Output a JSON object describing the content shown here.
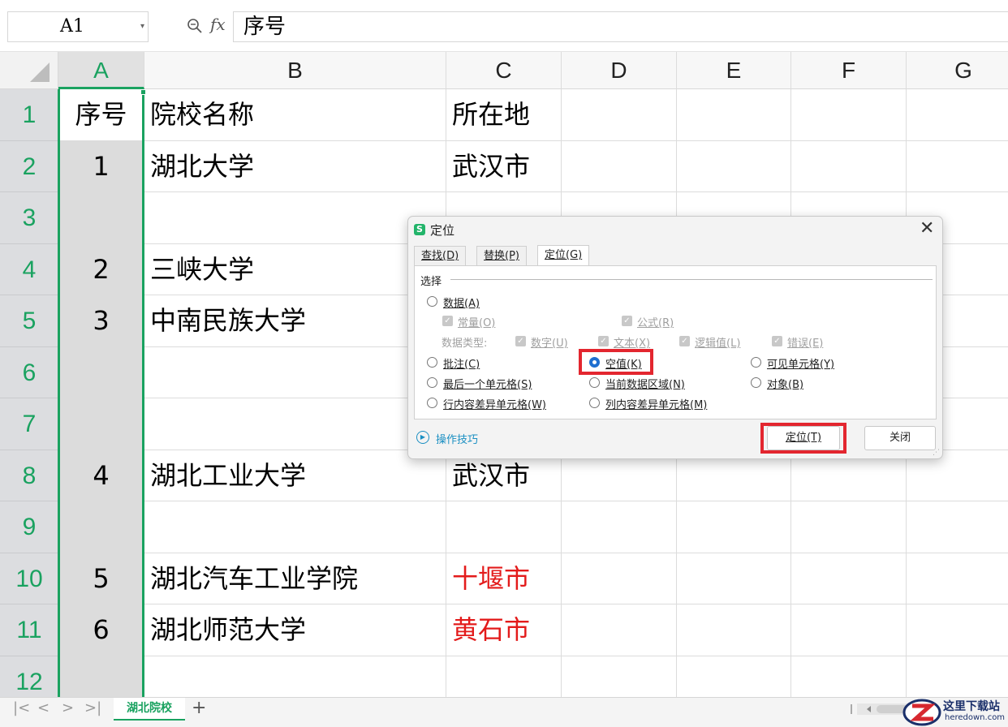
{
  "formula_bar": {
    "cell_ref": "A1",
    "fx_label": "fx",
    "content": "序号"
  },
  "columns": [
    "A",
    "B",
    "C",
    "D",
    "E",
    "F",
    "G"
  ],
  "rows": [
    {
      "num": "1",
      "a": "序号",
      "b": "院校名称",
      "c": "所在地"
    },
    {
      "num": "2",
      "a": "1",
      "b": "湖北大学",
      "c": "武汉市"
    },
    {
      "num": "3",
      "a": "",
      "b": "",
      "c": ""
    },
    {
      "num": "4",
      "a": "2",
      "b": "三峡大学",
      "c": ""
    },
    {
      "num": "5",
      "a": "3",
      "b": "中南民族大学",
      "c": ""
    },
    {
      "num": "6",
      "a": "",
      "b": "",
      "c": ""
    },
    {
      "num": "7",
      "a": "",
      "b": "",
      "c": ""
    },
    {
      "num": "8",
      "a": "4",
      "b": "湖北工业大学",
      "c": "武汉市"
    },
    {
      "num": "9",
      "a": "",
      "b": "",
      "c": ""
    },
    {
      "num": "10",
      "a": "5",
      "b": "湖北汽车工业学院",
      "c": "十堰市"
    },
    {
      "num": "11",
      "a": "6",
      "b": "湖北师范大学",
      "c": "黄石市"
    },
    {
      "num": "12",
      "a": "",
      "b": "",
      "c": ""
    }
  ],
  "red_text_color": "#e31b1b",
  "accent_color": "#1aa260",
  "sheet_tabs": {
    "active": "湖北院校",
    "add": "+"
  },
  "dialog": {
    "title": "定位",
    "close": "✕",
    "tabs": [
      "查找(D)",
      "替换(P)",
      "定位(G)"
    ],
    "group_label": "选择",
    "options": {
      "data": "数据(A)",
      "constants": "常量(O)",
      "formulas": "公式(R)",
      "data_type_label": "数据类型:",
      "numbers": "数字(U)",
      "text": "文本(X)",
      "logicals": "逻辑值(L)",
      "errors": "错误(E)",
      "comments": "批注(C)",
      "blanks": "空值(K)",
      "visible_cells": "可见单元格(Y)",
      "last_cell": "最后一个单元格(S)",
      "current_region": "当前数据区域(N)",
      "objects": "对象(B)",
      "row_differences": "行内容差异单元格(W)",
      "column_differences": "列内容差异单元格(M)"
    },
    "selected_option": "空值(K)",
    "tips": "操作技巧",
    "locate_button": "定位(T)",
    "close_button": "关闭"
  },
  "watermark": {
    "title": "这里下载站",
    "sub": "heredown.com"
  }
}
